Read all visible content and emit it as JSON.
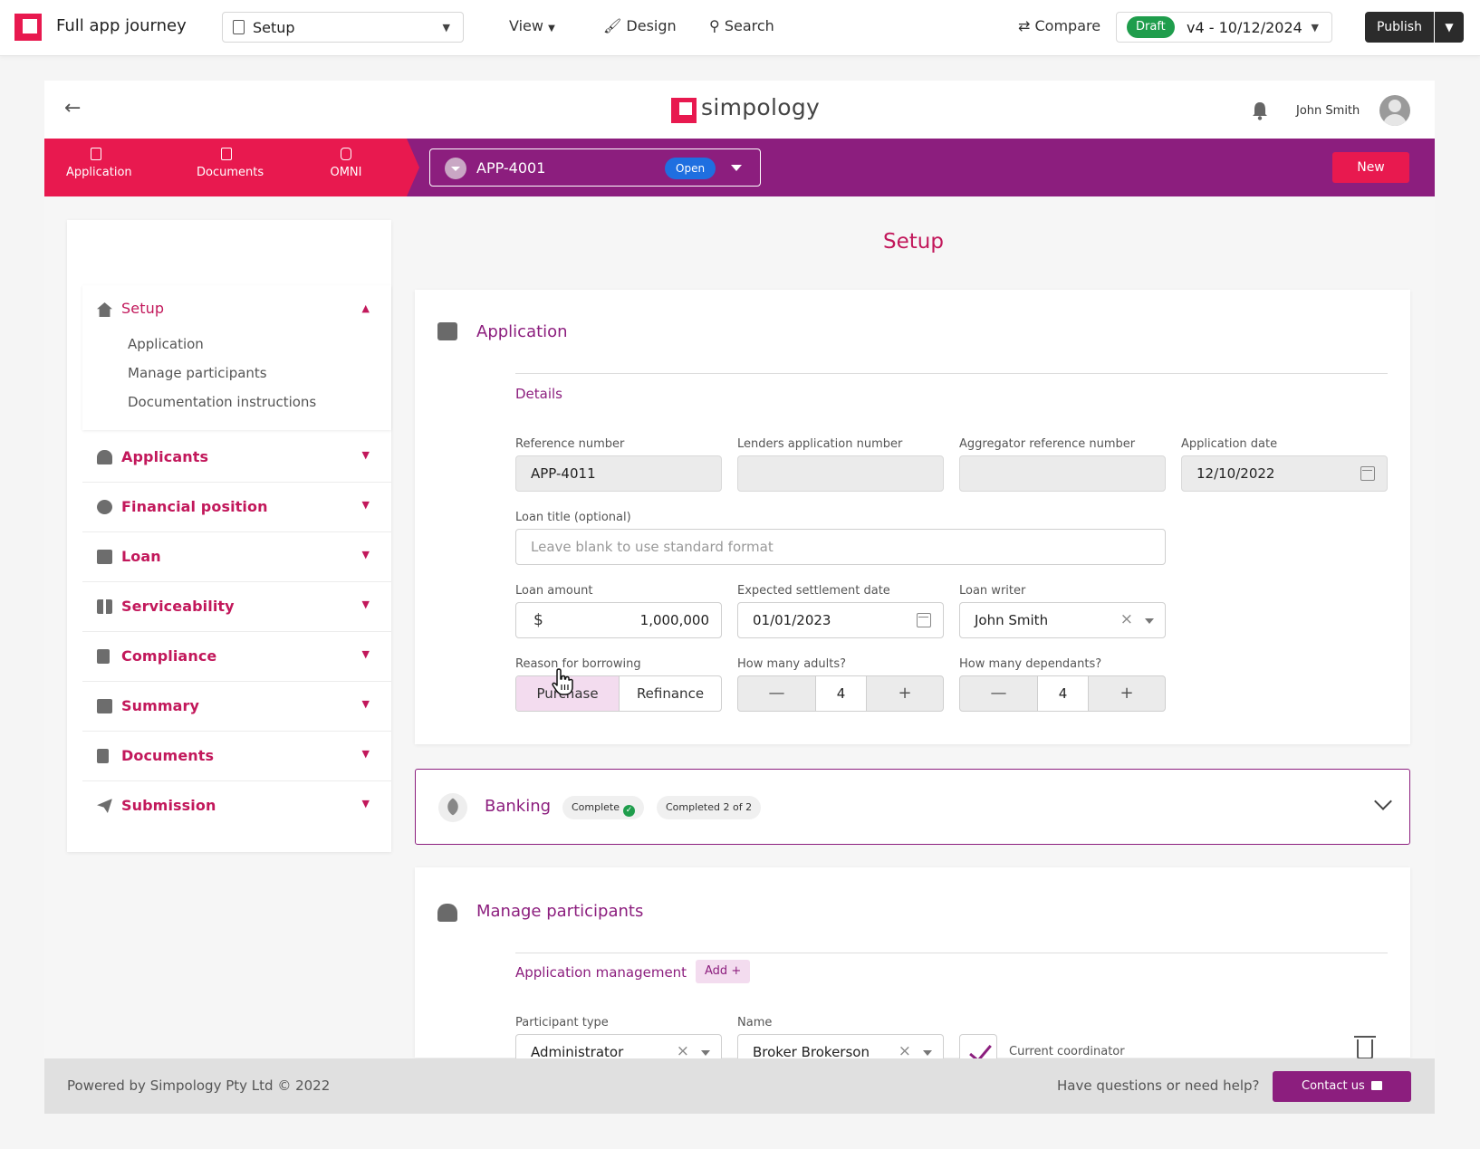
{
  "editor": {
    "title": "Full app journey",
    "page_select": "Setup",
    "view_label": "View",
    "design_label": "Design",
    "search_label": "Search",
    "compare_label": "Compare",
    "draft_badge": "Draft",
    "version": "v4 - 10/12/2024",
    "publish_label": "Publish"
  },
  "app": {
    "brand": "simpology",
    "user_name": "John Smith",
    "tabs": [
      {
        "label": "Application",
        "icon": "clipboard-icon"
      },
      {
        "label": "Documents",
        "icon": "copy-icon"
      },
      {
        "label": "OMNI",
        "icon": "chat-icon"
      }
    ],
    "app_id": "APP-4001",
    "app_status": "Open",
    "new_label": "New"
  },
  "sidebar": {
    "setup": {
      "label": "Setup",
      "children": [
        "Application",
        "Manage participants",
        "Documentation instructions"
      ]
    },
    "items": [
      {
        "label": "Applicants",
        "icon": "people-icon"
      },
      {
        "label": "Financial position",
        "icon": "dollar-circle-icon"
      },
      {
        "label": "Loan",
        "icon": "wallet-icon"
      },
      {
        "label": "Serviceability",
        "icon": "grid-icon"
      },
      {
        "label": "Compliance",
        "icon": "clipboard-check-icon"
      },
      {
        "label": "Summary",
        "icon": "scroll-icon"
      },
      {
        "label": "Documents",
        "icon": "file-icon"
      },
      {
        "label": "Submission",
        "icon": "send-icon"
      }
    ]
  },
  "main": {
    "page_title": "Setup",
    "application_card": {
      "title": "Application",
      "section": "Details",
      "reference_number_label": "Reference number",
      "reference_number": "APP-4011",
      "lenders_app_number_label": "Lenders application number",
      "aggregator_ref_label": "Aggregator reference number",
      "application_date_label": "Application date",
      "application_date": "12/10/2022",
      "loan_title_label": "Loan title (optional)",
      "loan_title_placeholder": "Leave blank to use standard format",
      "loan_amount_label": "Loan amount",
      "currency_symbol": "$",
      "loan_amount": "1,000,000",
      "settlement_date_label": "Expected settlement date",
      "settlement_date": "01/01/2023",
      "loan_writer_label": "Loan writer",
      "loan_writer": "John Smith",
      "reason_label": "Reason for borrowing",
      "reason_options": [
        "Purchase",
        "Refinance"
      ],
      "reason_selected": "Purchase",
      "adults_label": "How many adults?",
      "adults": "4",
      "dependants_label": "How many dependants?",
      "dependants": "4"
    },
    "banking": {
      "title": "Banking",
      "status": "Complete",
      "progress": "Completed 2 of 2"
    },
    "participants_card": {
      "title": "Manage participants",
      "section": "Application management",
      "add_label": "Add",
      "participant_type_label": "Participant type",
      "participant_type": "Administrator",
      "name_label": "Name",
      "name": "Broker Brokerson",
      "coordinator_label": "Current coordinator",
      "coordinator_checked": true
    }
  },
  "footer": {
    "powered_by": "Powered by Simpology Pty Ltd © 2022",
    "help_text": "Have questions or need help?",
    "contact_label": "Contact us"
  },
  "colors": {
    "brand_pink": "#e8194f",
    "brand_purple": "#8c1e7e",
    "success_green": "#1f9d4c",
    "open_blue": "#1f6fe0"
  }
}
